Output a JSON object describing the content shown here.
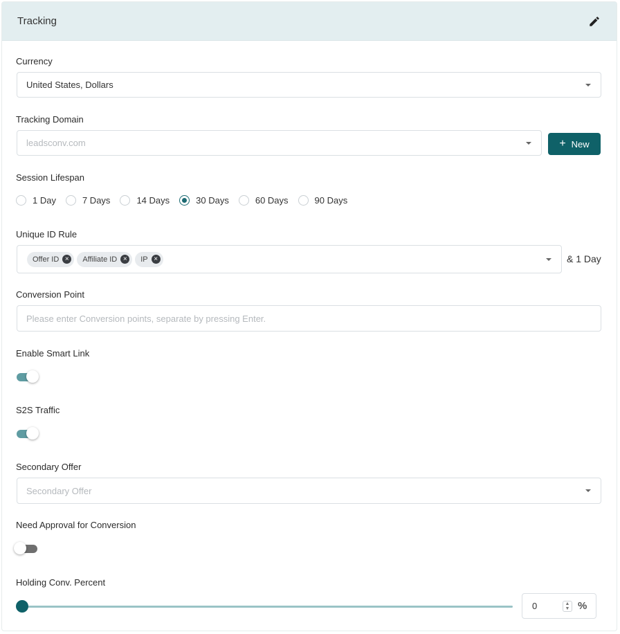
{
  "card": {
    "title": "Tracking",
    "edit_icon": "pencil-icon"
  },
  "currency": {
    "label": "Currency",
    "value": "United States, Dollars"
  },
  "tracking_domain": {
    "label": "Tracking Domain",
    "placeholder": "leadsconv.com",
    "new_button": "New",
    "new_icon": "plus-icon"
  },
  "session_lifespan": {
    "label": "Session Lifespan",
    "options": [
      "1 Day",
      "7 Days",
      "14 Days",
      "30 Days",
      "60 Days",
      "90 Days"
    ],
    "selected": "30 Days"
  },
  "unique_id_rule": {
    "label": "Unique ID Rule",
    "tags": [
      "Offer ID",
      "Affiliate ID",
      "IP"
    ],
    "suffix": "& 1 Day"
  },
  "conversion_point": {
    "label": "Conversion Point",
    "placeholder": "Please enter Conversion points, separate by pressing Enter."
  },
  "smart_link": {
    "label": "Enable Smart Link",
    "enabled": true
  },
  "s2s_traffic": {
    "label": "S2S Traffic",
    "enabled": true
  },
  "secondary_offer": {
    "label": "Secondary Offer",
    "placeholder": "Secondary Offer"
  },
  "approval": {
    "label": "Need Approval for Conversion",
    "enabled": false
  },
  "holding_percent": {
    "label": "Holding Conv. Percent",
    "value": "0",
    "slider_value": 0,
    "unit_icon": "percent-icon"
  },
  "colors": {
    "primary": "#0f6168",
    "header_bg": "#e3eef0",
    "toggle_on": "#5f9ca2"
  }
}
